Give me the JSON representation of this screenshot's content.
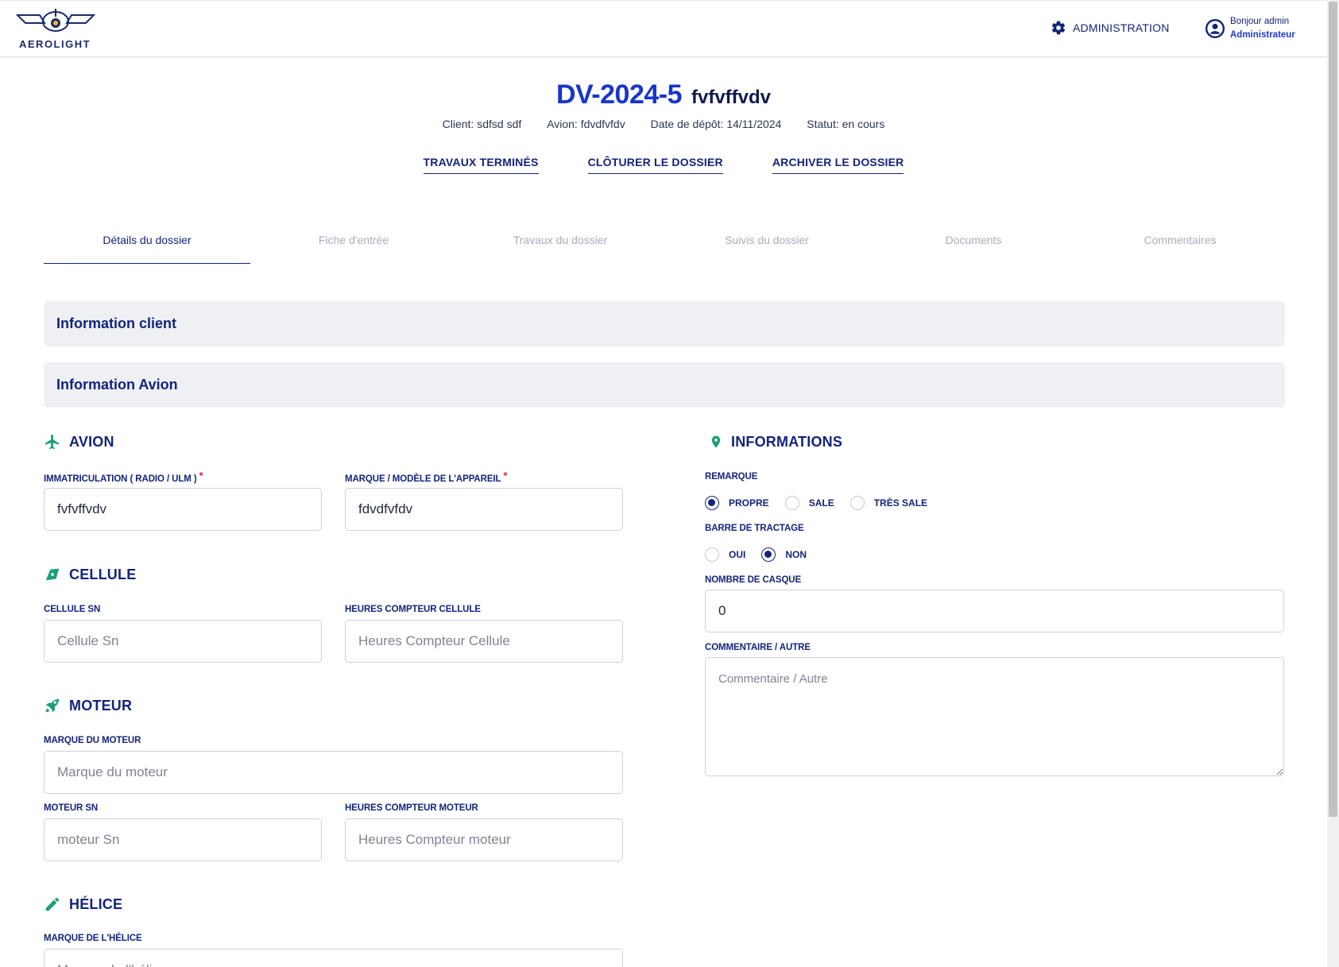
{
  "brand": {
    "name": "AEROLIGHT"
  },
  "header": {
    "admin_label": "ADMINISTRATION",
    "greeting": "Bonjour admin",
    "role": "Administrateur"
  },
  "dossier": {
    "code": "DV-2024-5",
    "registration": "fvfvffvdv",
    "client": "Client: sdfsd sdf",
    "avion": "Avion: fdvdfvfdv",
    "date_depot": "Date de dépôt: 14/11/2024",
    "statut": "Statut: en cours"
  },
  "actions": {
    "travaux_termines": "TRAVAUX TERMINÉS",
    "cloturer": "CLÔTURER LE DOSSIER",
    "archiver": "ARCHIVER LE DOSSIER"
  },
  "tabs": [
    {
      "label": "Détails du dossier"
    },
    {
      "label": "Fiche d'entrée"
    },
    {
      "label": "Travaux du dossier"
    },
    {
      "label": "Suivis du dossier"
    },
    {
      "label": "Documents"
    },
    {
      "label": "Commentaires"
    }
  ],
  "accordions": {
    "client": "Information client",
    "avion": "Information Avion"
  },
  "sections": {
    "avion": {
      "title": "AVION",
      "immat_label": "IMMATRICULATION ( RADIO / ULM )",
      "immat_value": "fvfvffvdv",
      "marque_label": "MARQUE / MODÈLE DE L'APPAREIL",
      "marque_value": "fdvdfvfdv",
      "required_mark": "*"
    },
    "cellule": {
      "title": "CELLULE",
      "sn_label": "CELLULE SN",
      "sn_placeholder": "Cellule Sn",
      "heures_label": "HEURES COMPTEUR CELLULE",
      "heures_placeholder": "Heures Compteur Cellule"
    },
    "moteur": {
      "title": "MOTEUR",
      "marque_label": "MARQUE DU MOTEUR",
      "marque_placeholder": "Marque du moteur",
      "sn_label": "MOTEUR SN",
      "sn_placeholder": "moteur Sn",
      "heures_label": "HEURES COMPTEUR MOTEUR",
      "heures_placeholder": "Heures Compteur moteur"
    },
    "helice": {
      "title": "HÉLICE",
      "marque_label": "MARQUE DE L'HÉLICE",
      "marque_placeholder": "Marque de l'hélice"
    },
    "informations": {
      "title": "INFORMATIONS",
      "remarque_label": "REMARQUE",
      "remarque_options": [
        "PROPRE",
        "SALE",
        "TRÈS SALE"
      ],
      "remarque_selected": "PROPRE",
      "barre_label": "BARRE DE TRACTAGE",
      "barre_options": [
        "OUI",
        "NON"
      ],
      "barre_selected": "NON",
      "casque_label": "NOMBRE DE CASQUE",
      "casque_value": "0",
      "commentaire_label": "COMMENTAIRE / AUTRE",
      "commentaire_placeholder": "Commentaire / Autre"
    }
  },
  "colors": {
    "primary": "#13247a",
    "title_blue": "#1a35c9",
    "accent_green": "#1e9e78",
    "required_red": "#d0263b",
    "panel_bg": "#eef0f4"
  }
}
